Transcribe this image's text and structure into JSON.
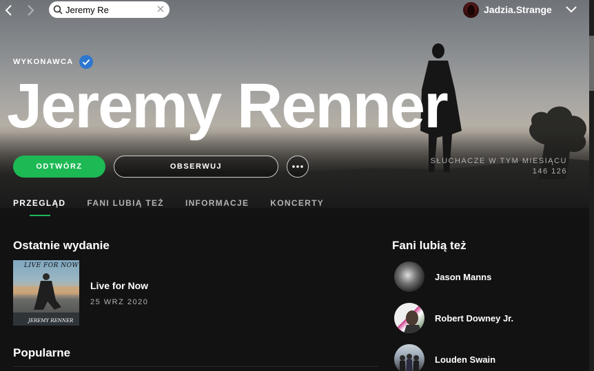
{
  "topbar": {
    "search_value": "Jeremy Re",
    "username": "Jadzia.Strange"
  },
  "artist": {
    "label": "WYKONAWCA",
    "name": "Jeremy Renner",
    "play_label": "ODTWÓRZ",
    "follow_label": "OBSERWUJ",
    "listeners_label": "SŁUCHACZE W TYM MIESIĄCU",
    "listeners_count": "146 126"
  },
  "tabs": [
    {
      "label": "PRZEGLĄD",
      "active": true
    },
    {
      "label": "FANI LUBIĄ TEŻ",
      "active": false
    },
    {
      "label": "INFORMACJE",
      "active": false
    },
    {
      "label": "KONCERTY",
      "active": false
    }
  ],
  "latest_release": {
    "section_title": "Ostatnie wydanie",
    "cover_title": "LIVE FOR NOW",
    "cover_artist": "JEREMY RENNER",
    "name": "Live for Now",
    "date": "25 WRZ 2020"
  },
  "fans_also_like": {
    "section_title": "Fani lubią też",
    "artists": [
      {
        "name": "Jason Manns"
      },
      {
        "name": "Robert Downey Jr."
      },
      {
        "name": "Louden Swain"
      }
    ]
  },
  "popular": {
    "section_title": "Popularne"
  },
  "colors": {
    "accent": "#1db954",
    "verified": "#2e77d0",
    "background": "#121212",
    "muted_text": "#b3b3b3"
  }
}
